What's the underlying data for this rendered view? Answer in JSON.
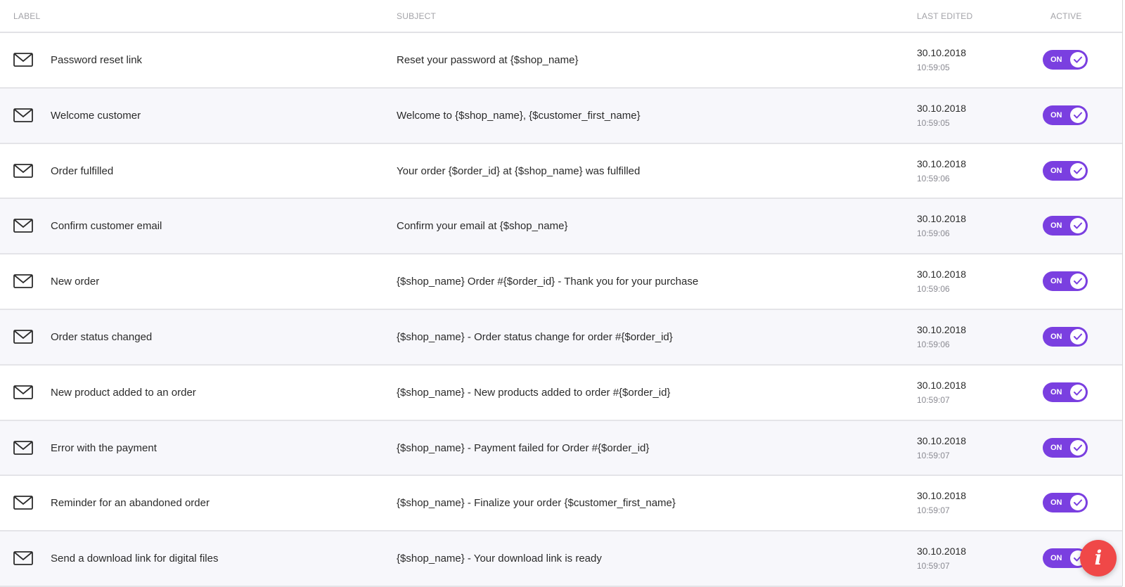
{
  "table": {
    "headers": {
      "label": "LABEL",
      "subject": "SUBJECT",
      "last_edited": "LAST EDITED",
      "active": "ACTIVE"
    },
    "rows": [
      {
        "label": "Password reset link",
        "subject": "Reset your password at {$shop_name}",
        "date": "30.10.2018",
        "time": "10:59:05",
        "active": true,
        "toggle_text": "ON"
      },
      {
        "label": "Welcome customer",
        "subject": "Welcome to {$shop_name}, {$customer_first_name}",
        "date": "30.10.2018",
        "time": "10:59:05",
        "active": true,
        "toggle_text": "ON"
      },
      {
        "label": "Order fulfilled",
        "subject": "Your order {$order_id} at {$shop_name} was fulfilled",
        "date": "30.10.2018",
        "time": "10:59:06",
        "active": true,
        "toggle_text": "ON"
      },
      {
        "label": "Confirm customer email",
        "subject": "Confirm your email at {$shop_name}",
        "date": "30.10.2018",
        "time": "10:59:06",
        "active": true,
        "toggle_text": "ON"
      },
      {
        "label": "New order",
        "subject": "{$shop_name} Order #{$order_id} - Thank you for your purchase",
        "date": "30.10.2018",
        "time": "10:59:06",
        "active": true,
        "toggle_text": "ON"
      },
      {
        "label": "Order status changed",
        "subject": "{$shop_name} - Order status change for order #{$order_id}",
        "date": "30.10.2018",
        "time": "10:59:06",
        "active": true,
        "toggle_text": "ON"
      },
      {
        "label": "New product added to an order",
        "subject": "{$shop_name} - New products added to order #{$order_id}",
        "date": "30.10.2018",
        "time": "10:59:07",
        "active": true,
        "toggle_text": "ON"
      },
      {
        "label": "Error with the payment",
        "subject": "{$shop_name} - Payment failed for Order #{$order_id}",
        "date": "30.10.2018",
        "time": "10:59:07",
        "active": true,
        "toggle_text": "ON"
      },
      {
        "label": "Reminder for an abandoned order",
        "subject": "{$shop_name} - Finalize your order {$customer_first_name}",
        "date": "30.10.2018",
        "time": "10:59:07",
        "active": true,
        "toggle_text": "ON"
      },
      {
        "label": "Send a download link for digital files",
        "subject": "{$shop_name} - Your download link is ready",
        "date": "30.10.2018",
        "time": "10:59:07",
        "active": true,
        "toggle_text": "ON"
      }
    ]
  },
  "icons": {
    "row_icon": "envelope-icon",
    "toggle_icon": "checkmark-icon",
    "fab_icon": "info-icon"
  },
  "fab": {
    "glyph": "i"
  },
  "colors": {
    "accent": "#7a3fe0",
    "fab": "#f04848",
    "row_alt": "#f7f7fb",
    "header_text": "#a3a3a8"
  }
}
